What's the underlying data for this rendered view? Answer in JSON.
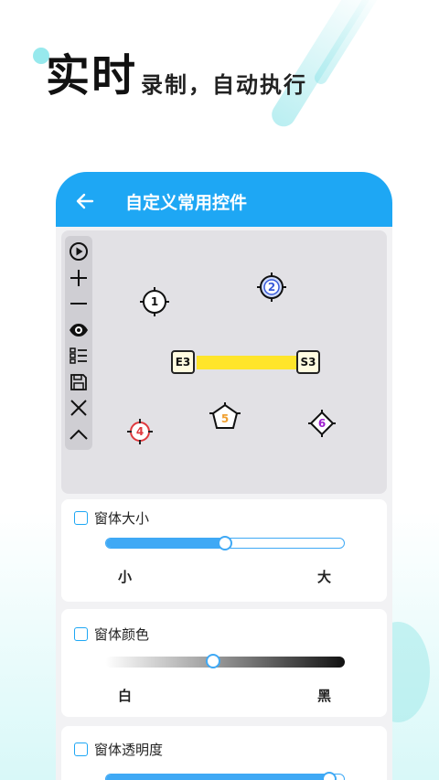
{
  "headline": {
    "big": "实时",
    "small": "录制，自动执行"
  },
  "titlebar": {
    "title": "自定义常用控件"
  },
  "toolbar": {
    "items": [
      "play-icon",
      "plus-icon",
      "minus-icon",
      "eye-icon",
      "list-icon",
      "save-icon",
      "close-icon",
      "chevron-up-icon"
    ]
  },
  "markers": {
    "m1": "1",
    "m2": "2",
    "m4": "4",
    "m5": "5",
    "m6": "6",
    "e3": "E3",
    "s3": "S3"
  },
  "colors": {
    "accent": "#1ea7f4",
    "m2": "#3a5bd9",
    "m4": "#e0393e",
    "m5": "#f0a030",
    "m6": "#a020d0",
    "segment": "#ffe52a"
  },
  "settings": {
    "size": {
      "label": "窗体大小",
      "min": "小",
      "max": "大",
      "value_fraction": 0.5
    },
    "color": {
      "label": "窗体颜色",
      "min": "白",
      "max": "黑",
      "value_fraction": 0.45
    },
    "opacity": {
      "label": "窗体透明度"
    }
  }
}
